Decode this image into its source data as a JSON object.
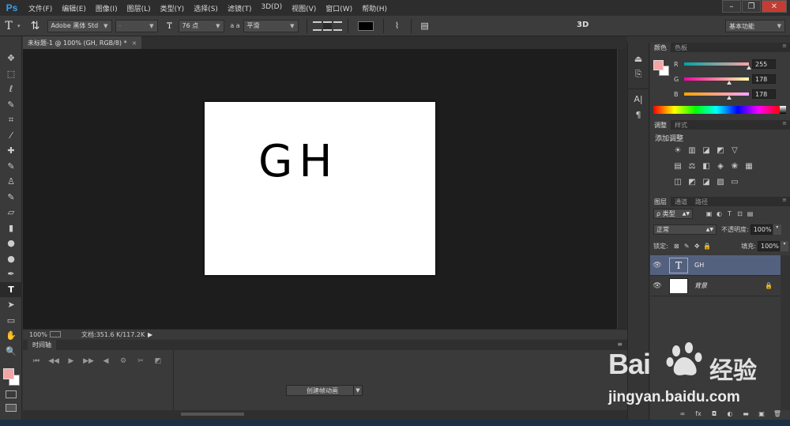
{
  "app": {
    "logo": "Ps"
  },
  "menu": [
    "文件(F)",
    "编辑(E)",
    "图像(I)",
    "图层(L)",
    "类型(Y)",
    "选择(S)",
    "滤镜(T)",
    "3D(D)",
    "视图(V)",
    "窗口(W)",
    "帮助(H)"
  ],
  "window_controls": {
    "minimize": "–",
    "restore": "❐",
    "close": "✕"
  },
  "options": {
    "font_family": "Adobe 黑体 Std",
    "font_style": "-",
    "font_size": "76 点",
    "aa_icon_label": "a a",
    "antialias": "平滑",
    "text_color": "#000000",
    "label_3d": "3D",
    "workspace": "基本功能"
  },
  "toolbar": {
    "tools": [
      "move-tool",
      "marquee-tool",
      "lasso-tool",
      "quick-select-tool",
      "crop-tool",
      "eyedropper-tool",
      "healing-tool",
      "brush-tool",
      "stamp-tool",
      "history-brush-tool",
      "eraser-tool",
      "gradient-tool",
      "blur-tool",
      "dodge-tool",
      "pen-tool",
      "type-tool",
      "path-select-tool",
      "shape-tool",
      "hand-tool",
      "zoom-tool"
    ],
    "glyphs": [
      "✥",
      "⬚",
      "ℓ",
      "✎",
      "⌗",
      "⁄",
      "✚",
      "✎",
      "♙",
      "✎",
      "▱",
      "▮",
      "●",
      "●",
      "✒",
      "T",
      "➤",
      "▭",
      "✋",
      "🔍"
    ],
    "active_tool": "type-tool",
    "foreground_color": "#f4a4a4",
    "background_color": "#ffffff"
  },
  "document": {
    "tab_title": "未标题-1 @ 100% (GH, RGB/8) *",
    "tab_close": "×",
    "canvas_text": "GH",
    "zoom": "100%",
    "doc_info": "文档:351.6 K/117.2K",
    "status_arrow": "▶"
  },
  "timeline": {
    "tab": "时间轴",
    "menu": "≡",
    "controls": [
      "⏮",
      "◀◀",
      "▶",
      "▶▶",
      "◀",
      "⚙",
      "✂",
      "◩"
    ],
    "create_button": "创建帧动画",
    "create_arrow": "▼"
  },
  "dock": {
    "icons": [
      "⏏",
      "⎘",
      "A|",
      "¶"
    ]
  },
  "color_panel": {
    "tabs": [
      "颜色",
      "色板"
    ],
    "menu": "≡",
    "foreground": "#f4a4a4",
    "background": "#ffffff",
    "channels": [
      {
        "label": "R",
        "value": "255",
        "gradient": "#00a4a4,#ffa4a4",
        "thumb": 1.0
      },
      {
        "label": "G",
        "value": "178",
        "gradient": "#ff00a4,#ffffa4",
        "thumb": 0.698
      },
      {
        "label": "B",
        "value": "178",
        "gradient": "#ffa400,#ffa4ff",
        "thumb": 0.698
      }
    ]
  },
  "adjustments_panel": {
    "tabs": [
      "调整",
      "样式"
    ],
    "title": "添加调整",
    "rows": [
      [
        "☀",
        "▥",
        "◪",
        "◩",
        "▽"
      ],
      [
        "▤",
        "⚖",
        "◧",
        "◈",
        "❀",
        "▦"
      ],
      [
        "◫",
        "◩",
        "◪",
        "▨",
        "▭"
      ]
    ]
  },
  "layers_panel": {
    "tabs": [
      "图层",
      "通道",
      "路径"
    ],
    "filter_label": "ρ 类型",
    "filter_icons": [
      "▣",
      "◐",
      "T",
      "⊡",
      "▤"
    ],
    "blend_mode": "正常",
    "opacity_label": "不透明度:",
    "opacity_value": "100%",
    "lock_label": "锁定:",
    "lock_icons": [
      "⊠",
      "✎",
      "✥",
      "🔒"
    ],
    "fill_label": "填充:",
    "fill_value": "100%",
    "layers": [
      {
        "name": "GH",
        "type": "text",
        "thumb_glyph": "T",
        "selected": true
      },
      {
        "name": "背景",
        "type": "background",
        "thumb_glyph": "",
        "selected": false,
        "lock": "🔒"
      }
    ],
    "eye_glyph": "👁",
    "footer_icons": [
      "∞",
      "fx",
      "◘",
      "◐",
      "▬",
      "▣",
      "🗑"
    ]
  },
  "watermark": {
    "logo": "Bai",
    "logo_cn": "经验",
    "url": "jingyan.baidu.com"
  }
}
